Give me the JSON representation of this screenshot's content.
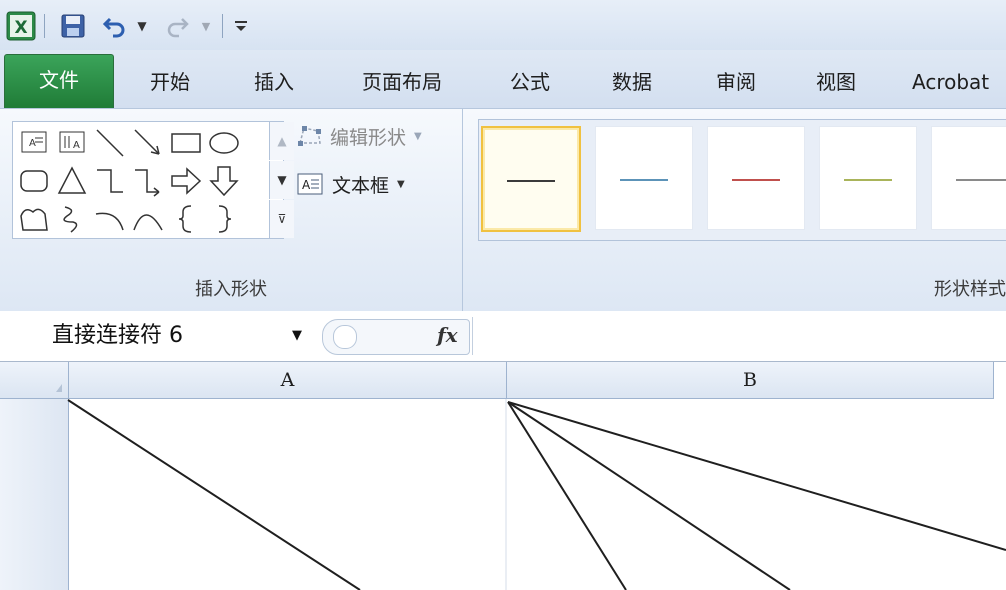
{
  "quick_access": {
    "app_icon": "excel-icon",
    "save_icon": "save-icon",
    "undo_icon": "undo-icon",
    "redo_icon": "redo-icon",
    "customize_icon": "customize-qat-icon"
  },
  "tabs": [
    {
      "label": "文件",
      "active": true
    },
    {
      "label": "开始"
    },
    {
      "label": "插入"
    },
    {
      "label": "页面布局"
    },
    {
      "label": "公式"
    },
    {
      "label": "数据"
    },
    {
      "label": "审阅"
    },
    {
      "label": "视图"
    },
    {
      "label": "Acrobat"
    }
  ],
  "ribbon": {
    "insert_shapes": {
      "group_label": "插入形状",
      "edit_shape": "编辑形状",
      "text_box": "文本框",
      "shapes": [
        "text-box-shape",
        "vertical-text-box-shape",
        "line-shape",
        "arrow-shape",
        "rectangle-shape",
        "oval-shape",
        "rounded-rectangle-shape",
        "triangle-shape",
        "elbow-connector-shape",
        "elbow-arrow-connector-shape",
        "right-arrow-shape",
        "down-arrow-shape",
        "freeform-shape",
        "scribble-shape",
        "arc-shape",
        "curve-shape",
        "left-brace-shape",
        "right-brace-shape"
      ]
    },
    "shape_styles": {
      "group_label": "形状样式",
      "swatches": [
        {
          "color": "#3b3b3b",
          "selected": true
        },
        {
          "color": "#5c93b8"
        },
        {
          "color": "#c0504d"
        },
        {
          "color": "#a9b45a"
        },
        {
          "color": "#8a8a8a"
        }
      ]
    }
  },
  "formula_bar": {
    "name_box": "直接连接符 6",
    "fx_label": "fx",
    "formula": ""
  },
  "sheet": {
    "columns": [
      "A",
      "B"
    ],
    "line_color": "#1f1f1f"
  }
}
